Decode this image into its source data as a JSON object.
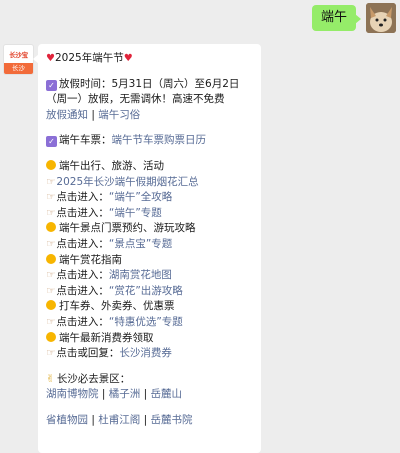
{
  "user_message": {
    "text": "端午"
  },
  "bot": {
    "logo_top": "长沙宝",
    "logo_bottom": "长沙"
  },
  "message": {
    "title": "2025年端午节",
    "holiday": {
      "prefix": "放假时间：5月31日（周六）至6月2日（周一）放假，无需调休！高速不免费",
      "link1": "放假通知",
      "link2": "端午习俗"
    },
    "ticket": {
      "prefix": "端午车票：",
      "link": "端午节车票购票日历"
    },
    "items": [
      {
        "type": "sun",
        "text": "端午出行、旅游、活动"
      },
      {
        "type": "hand",
        "link": "2025年长沙端午假期烟花汇总"
      },
      {
        "type": "hand",
        "text": "点击进入：",
        "link": "“端午”全攻略"
      },
      {
        "type": "hand",
        "text": "点击进入：",
        "link": "“端午”专题"
      },
      {
        "type": "sun",
        "text": "端午景点门票预约、游玩攻略"
      },
      {
        "type": "hand",
        "text": "点击进入：",
        "link": "“景点宝”专题"
      },
      {
        "type": "sun",
        "text": "端午赏花指南"
      },
      {
        "type": "hand",
        "text": "点击进入：",
        "link": "湖南赏花地图"
      },
      {
        "type": "hand",
        "text": "点击进入：",
        "link": "“赏花”出游攻略"
      },
      {
        "type": "sun",
        "text": "打车券、外卖券、优惠票"
      },
      {
        "type": "hand",
        "text": "点击进入：",
        "link": "“特惠优选”专题"
      },
      {
        "type": "sun",
        "text": "端午最新消费券领取"
      },
      {
        "type": "hand",
        "text": "点击或回复：",
        "link": "长沙消费券"
      }
    ],
    "scenic": {
      "title": "长沙必去景区：",
      "row1": [
        "湖南博物院",
        "橘子洲",
        "岳麓山"
      ],
      "row2": [
        "省植物园",
        "杜甫江阁",
        "岳麓书院"
      ],
      "separator": "|"
    }
  }
}
